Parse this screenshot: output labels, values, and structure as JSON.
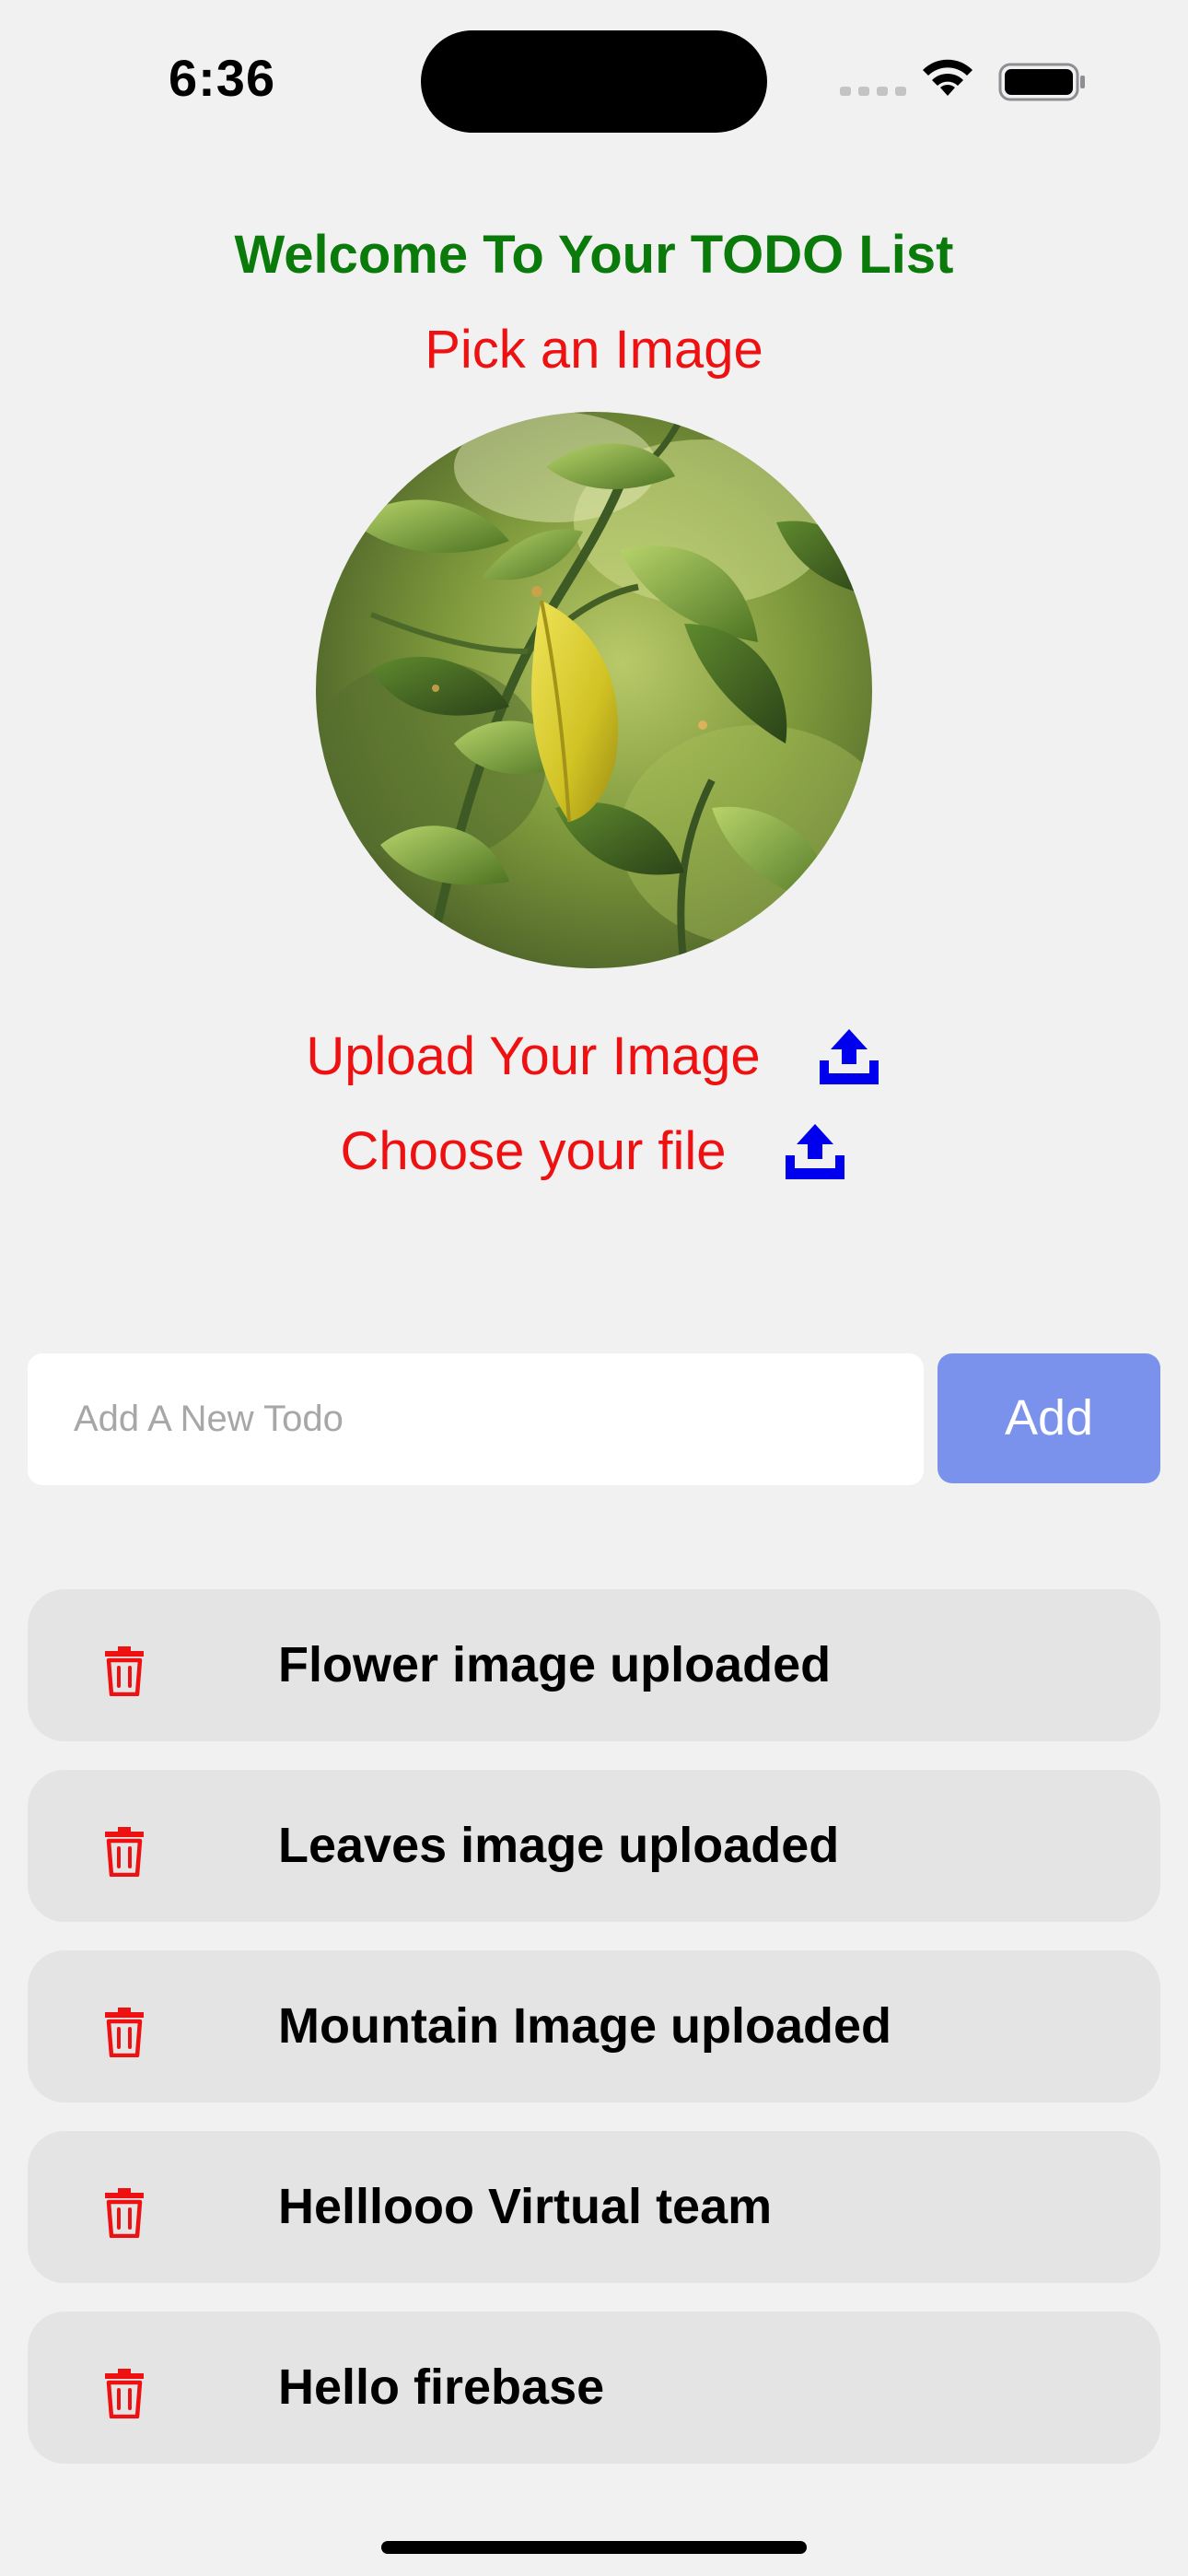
{
  "status_bar": {
    "time": "6:36"
  },
  "header": {
    "title": "Welcome To Your TODO List",
    "title_color": "#0a7a0a",
    "pick_image_label": "Pick an Image",
    "accent_red": "#ee1111"
  },
  "image_picker": {
    "image_icon": "photo-leaves"
  },
  "upload": {
    "upload_label": "Upload Your Image",
    "choose_label": "Choose your file",
    "icon": "upload-tray-icon",
    "icon_color": "#0000ee"
  },
  "new_todo": {
    "placeholder": "Add A New Todo",
    "value": "",
    "add_label": "Add",
    "add_color": "#7a92eb"
  },
  "todos": [
    {
      "text": "Flower image uploaded"
    },
    {
      "text": "Leaves image uploaded"
    },
    {
      "text": "Mountain Image uploaded"
    },
    {
      "text": "Helllooo Virtual team"
    },
    {
      "text": "Hello firebase"
    }
  ],
  "todo_item": {
    "delete_icon": "trash-icon",
    "delete_color": "#ee1111"
  }
}
